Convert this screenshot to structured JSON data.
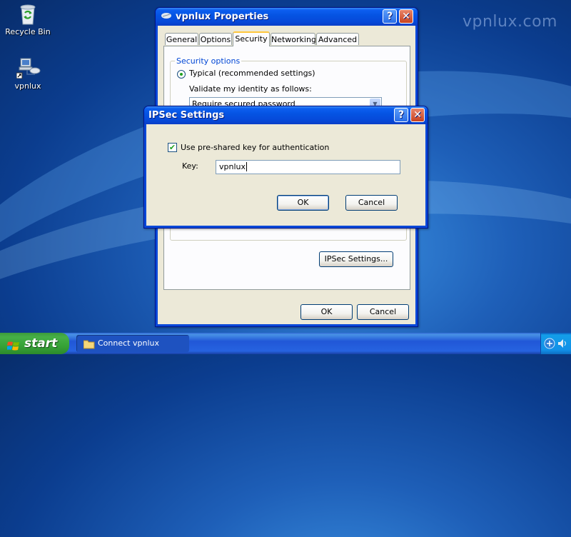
{
  "desktop": {
    "icons": [
      {
        "label": "Recycle Bin",
        "icon": "recycle-bin-icon"
      },
      {
        "label": "vpnlux",
        "icon": "network-connection-icon"
      }
    ],
    "watermark": "vpnlux.com"
  },
  "properties_window": {
    "title": "vpnlux Properties",
    "tabs": [
      "General",
      "Options",
      "Security",
      "Networking",
      "Advanced"
    ],
    "active_tab": "Security",
    "security_group_label": "Security options",
    "typical_radio_label": "Typical (recommended settings)",
    "validate_label": "Validate my identity as follows:",
    "validate_value": "Require secured password",
    "ipsec_button": "IPSec Settings...",
    "ok_button": "OK",
    "cancel_button": "Cancel"
  },
  "ipsec_dialog": {
    "title": "IPSec Settings",
    "checkbox_label": "Use pre-shared key for authentication",
    "checkbox_checked": true,
    "key_label": "Key:",
    "key_value": "vpnlux",
    "ok_button": "OK",
    "cancel_button": "Cancel"
  },
  "taskbar": {
    "start_label": "start",
    "task_item_label": "Connect vpnlux"
  }
}
